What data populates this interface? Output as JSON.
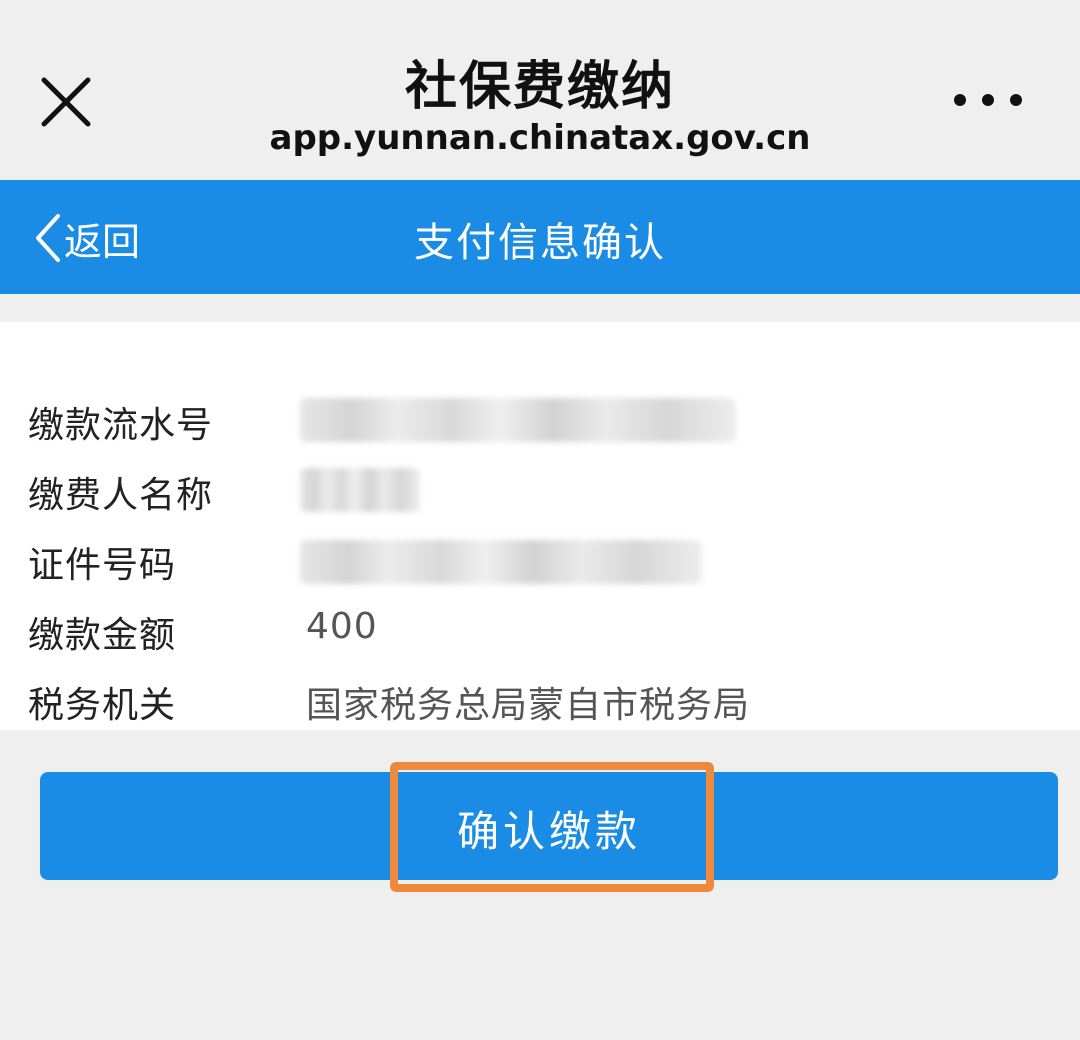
{
  "browser": {
    "title": "社保费缴纳",
    "url": "app.yunnan.chinatax.gov.cn",
    "close_icon": "close-icon",
    "more_icon": "more-icon"
  },
  "header": {
    "back_label": "返回",
    "title": "支付信息确认",
    "accent_color": "#1a8ce6"
  },
  "info": {
    "rows": [
      {
        "label": "缴款流水号",
        "value": ""
      },
      {
        "label": "缴费人名称",
        "value": ""
      },
      {
        "label": "证件号码",
        "value": ""
      },
      {
        "label": "缴款金额",
        "value": "400"
      },
      {
        "label": "税务机关",
        "value": "国家税务总局蒙自市税务局"
      }
    ]
  },
  "actions": {
    "confirm_label": "确认缴款",
    "highlight_color": "#ef8a3d"
  }
}
